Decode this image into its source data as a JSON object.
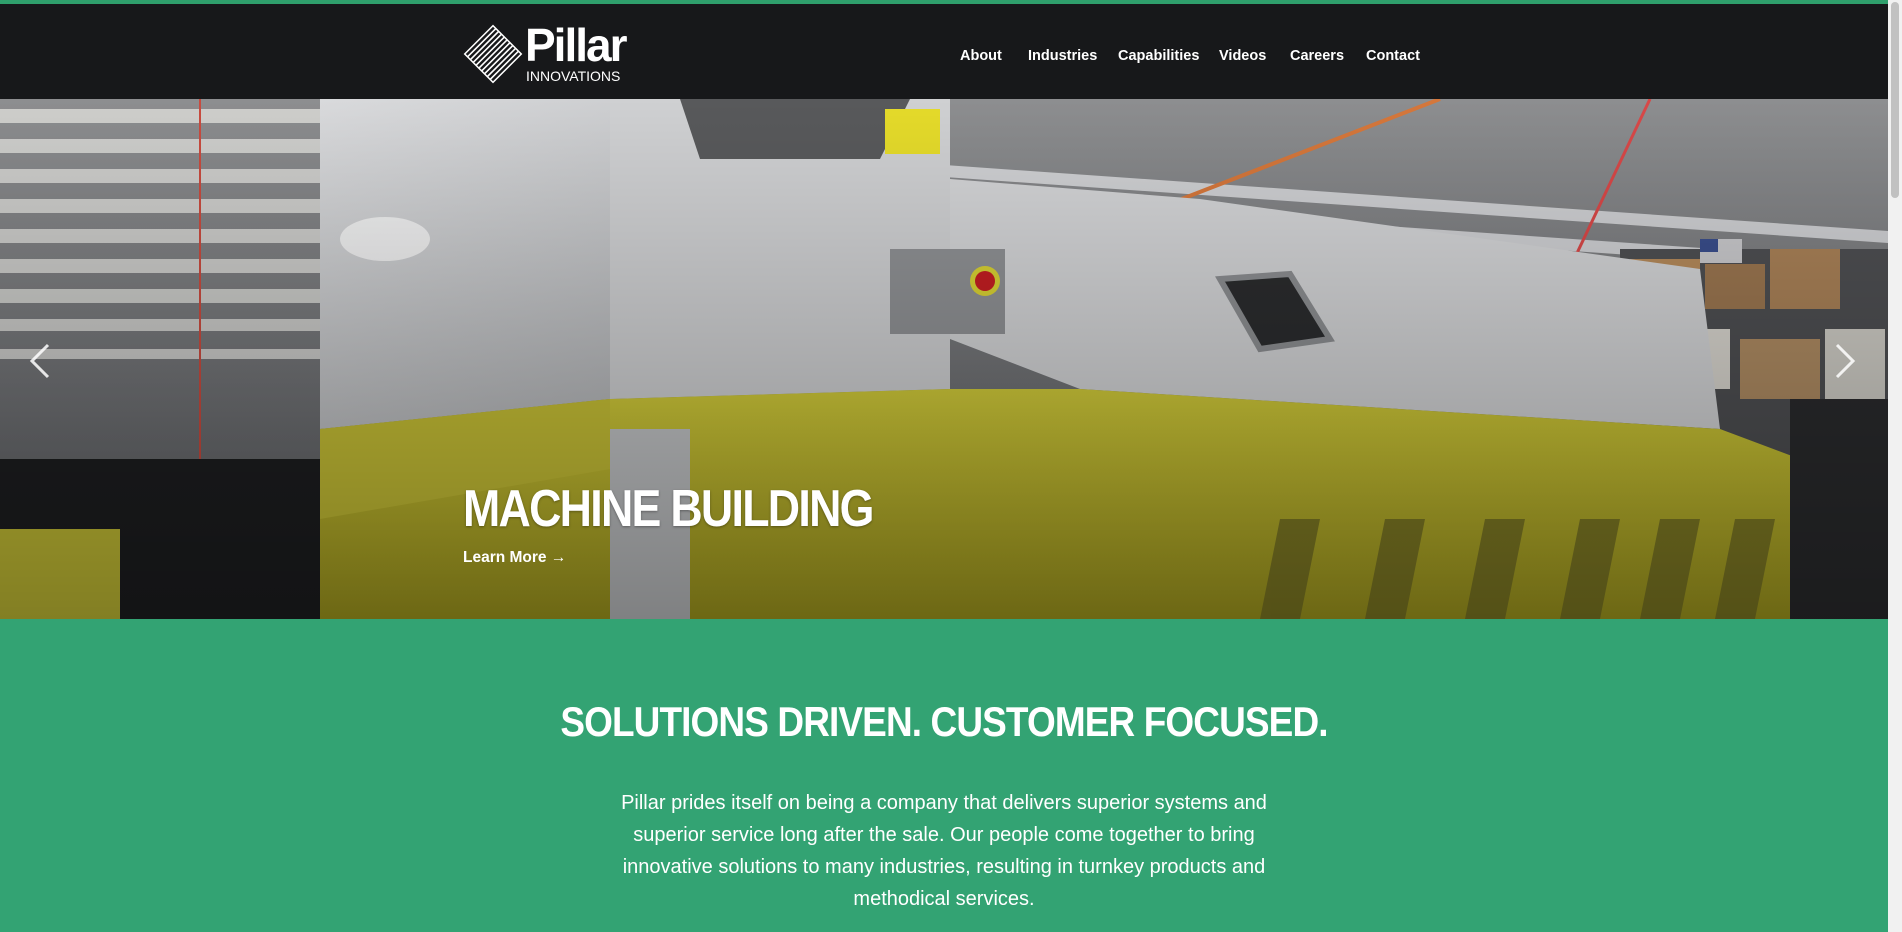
{
  "brand": {
    "name": "Pillar",
    "subtitle": "INNOVATIONS",
    "accent_color": "#33a373",
    "header_color": "#17181a"
  },
  "nav": {
    "items": [
      {
        "label": "About"
      },
      {
        "label": "Industries"
      },
      {
        "label": "Capabilities"
      },
      {
        "label": "Videos"
      },
      {
        "label": "Careers"
      },
      {
        "label": "Contact"
      }
    ]
  },
  "hero": {
    "title": "MACHINE BUILDING",
    "link_label": "Learn More →",
    "prev_icon": "chevron-left-icon",
    "next_icon": "chevron-right-icon"
  },
  "intro": {
    "title": "SOLUTIONS DRIVEN. CUSTOMER FOCUSED.",
    "body": "Pillar prides itself on being a company that delivers superior systems and superior service long after the sale. Our people come together to bring innovative solutions to many industries, resulting in turnkey products and methodical services."
  }
}
